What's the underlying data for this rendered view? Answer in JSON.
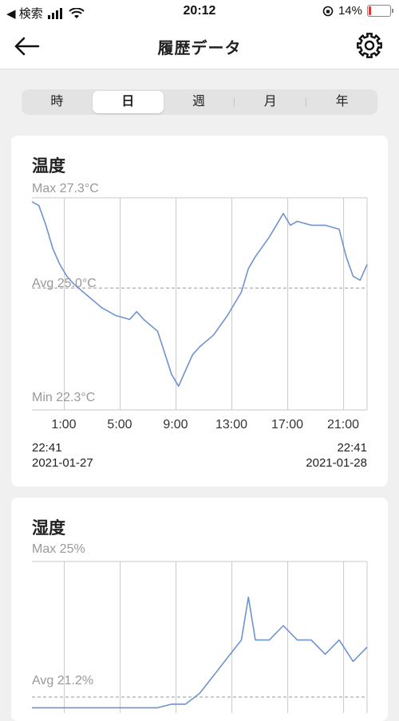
{
  "status_bar": {
    "back_app": "◀ 検索",
    "time": "20:12",
    "battery": "14%",
    "battery_level": 0.14
  },
  "nav": {
    "title": "履歴データ",
    "back_icon": "arrow-left-icon",
    "settings_icon": "gear-icon"
  },
  "segments": {
    "items": [
      "時",
      "日",
      "週",
      "月",
      "年"
    ],
    "selected": "日"
  },
  "temperature": {
    "title": "温度",
    "max_label": "Max 27.3°C",
    "avg_label": "Avg 25.0°C",
    "min_label": "Min 22.3°C",
    "ticks": [
      "1:00",
      "5:00",
      "9:00",
      "13:00",
      "17:00",
      "21:00"
    ],
    "start_time": "22:41",
    "start_date": "2021-01-27",
    "end_time": "22:41",
    "end_date": "2021-01-28"
  },
  "humidity": {
    "title": "湿度",
    "max_label": "Max 25%",
    "avg_label": "Avg 21.2%"
  },
  "colors": {
    "line": "#6f93cf",
    "accent_segment": "#ffffff",
    "battery_low": "#e33333"
  },
  "chart_data": [
    {
      "type": "line",
      "title": "温度",
      "unit": "°C",
      "y_max": 27.3,
      "y_avg": 25.0,
      "y_min": 22.3,
      "x_start": "2021-01-27 22:41",
      "x_end": "2021-01-28 22:41",
      "x_ticks": [
        "1:00",
        "5:00",
        "9:00",
        "13:00",
        "17:00",
        "21:00"
      ],
      "x_hours": [
        0,
        0.5,
        1,
        1.5,
        2,
        2.5,
        3,
        4,
        5,
        6,
        7,
        7.5,
        8,
        9,
        10,
        10.5,
        11,
        11.5,
        12,
        13,
        14,
        15,
        15.5,
        16,
        17,
        18,
        18.5,
        19,
        20,
        21,
        22,
        22.5,
        23,
        23.5,
        24
      ],
      "values": [
        27.2,
        27.1,
        26.6,
        26.0,
        25.6,
        25.3,
        25.1,
        24.8,
        24.5,
        24.3,
        24.2,
        24.4,
        24.2,
        23.9,
        22.8,
        22.5,
        22.9,
        23.3,
        23.5,
        23.8,
        24.3,
        24.9,
        25.5,
        25.8,
        26.3,
        26.9,
        26.6,
        26.7,
        26.6,
        26.6,
        26.5,
        25.8,
        25.3,
        25.2,
        25.6
      ],
      "grid": true,
      "avg_line": "dashed"
    },
    {
      "type": "line",
      "title": "湿度",
      "unit": "%",
      "y_max": 25,
      "y_avg": 21.2,
      "x_hours": [
        0,
        6,
        9,
        10,
        11,
        12,
        13,
        14,
        15,
        15.5,
        16,
        17,
        18,
        19,
        20,
        21,
        22,
        23,
        24
      ],
      "values": [
        20.9,
        20.9,
        20.9,
        21.0,
        21.0,
        21.3,
        21.8,
        22.3,
        22.8,
        24.0,
        22.8,
        22.8,
        23.2,
        22.8,
        22.8,
        22.4,
        22.8,
        22.2,
        22.6
      ],
      "grid": true,
      "avg_line": "dashed"
    }
  ]
}
